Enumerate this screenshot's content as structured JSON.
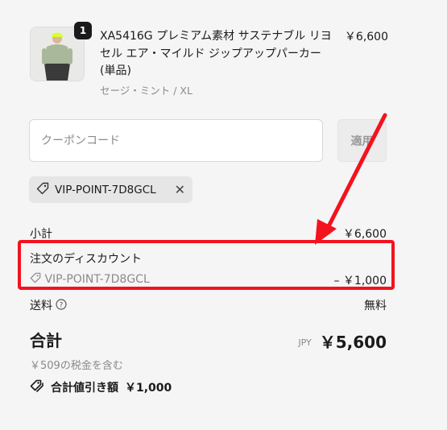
{
  "product": {
    "quantity": "1",
    "name": "XA5416G プレミアム素材 サステナブル リヨセル エア・マイルド ジップアップパーカー(単品)",
    "variant": "セージ・ミント / XL",
    "price": "￥6,600",
    "image_icon": "product-photo"
  },
  "coupon": {
    "placeholder": "クーポンコード",
    "apply_label": "適用"
  },
  "applied_code": {
    "code": "VIP-POINT-7D8GCL",
    "tag_icon": "tag-icon",
    "remove_icon": "close-icon"
  },
  "summary": {
    "subtotal_label": "小計",
    "subtotal_value": "￥6,600",
    "discount_label": "注文のディスカウント",
    "discount_code": "VIP-POINT-7D8GCL",
    "discount_value": "– ￥1,000",
    "shipping_label": "送料",
    "shipping_value": "無料",
    "total_label": "合計",
    "total_currency": "JPY",
    "total_value": "￥5,600",
    "tax_note": "￥509の税金を含む",
    "savings_label": "合計値引き額",
    "savings_value": "￥1,000"
  },
  "annotation": {
    "color": "#f2131f"
  }
}
